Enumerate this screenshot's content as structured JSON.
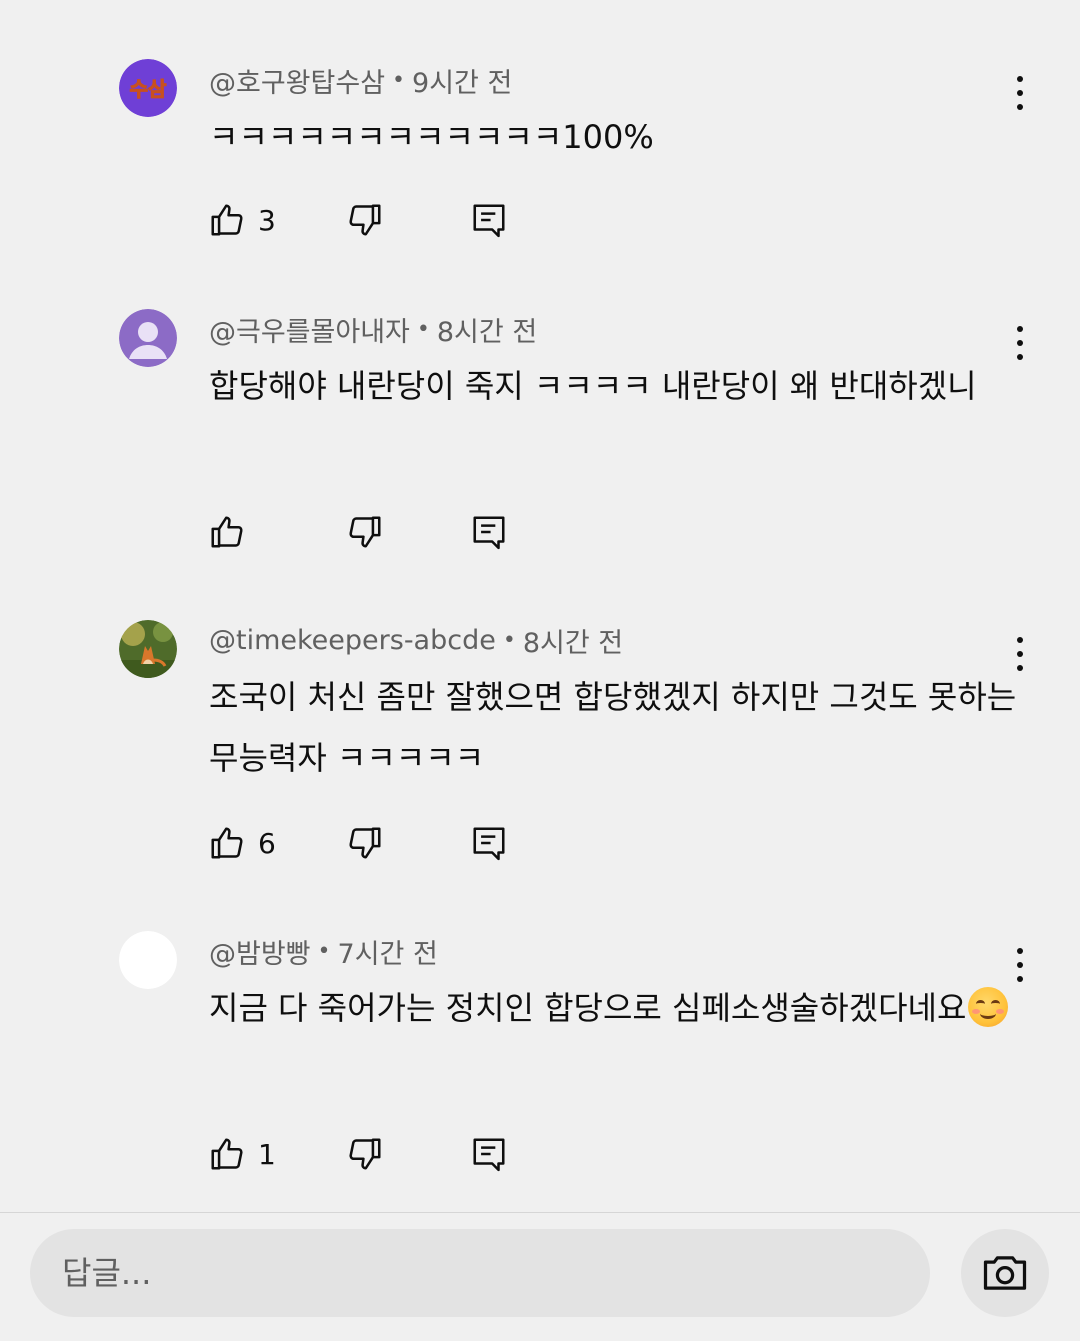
{
  "comments": [
    {
      "author": "@호구왕탑수삼",
      "time": "9시간 전",
      "text": "ㅋㅋㅋㅋㅋㅋㅋㅋㅋㅋㅋㅋ100%",
      "likes": "3",
      "avatar_label": "수삼",
      "avatar_icon": "text-avatar"
    },
    {
      "author": "@극우를몰아내자",
      "time": "8시간 전",
      "text": "합당해야 내란당이 죽지 ㅋㅋㅋㅋ 내란당이 왜 반대하겠니",
      "likes": "",
      "avatar_icon": "default-person-avatar"
    },
    {
      "author": "@timekeepers-abcde",
      "time": "8시간 전",
      "text": "조국이 처신 좀만 잘했으면 합당했겠지 하지만 그것도 못하는 무능력자 ㅋㅋㅋㅋㅋ",
      "likes": "6",
      "avatar_icon": "fox-photo-avatar"
    },
    {
      "author": "@밤방빵",
      "time": "7시간 전",
      "text": "지금 다 죽어가는 정치인 합당으로 심페소생술하겠다네요",
      "emoji": "smiling-face-emoji",
      "likes": "1",
      "avatar_icon": "blank-avatar"
    }
  ],
  "reply": {
    "placeholder": "답글...",
    "camera_icon": "camera-icon"
  },
  "colors": {
    "background": "#f0f0f0",
    "meta_text": "#606060",
    "input_bg": "#e3e3e3",
    "avatar_purple": "#6f3fd6",
    "avatar_default": "#8c6bc6"
  }
}
